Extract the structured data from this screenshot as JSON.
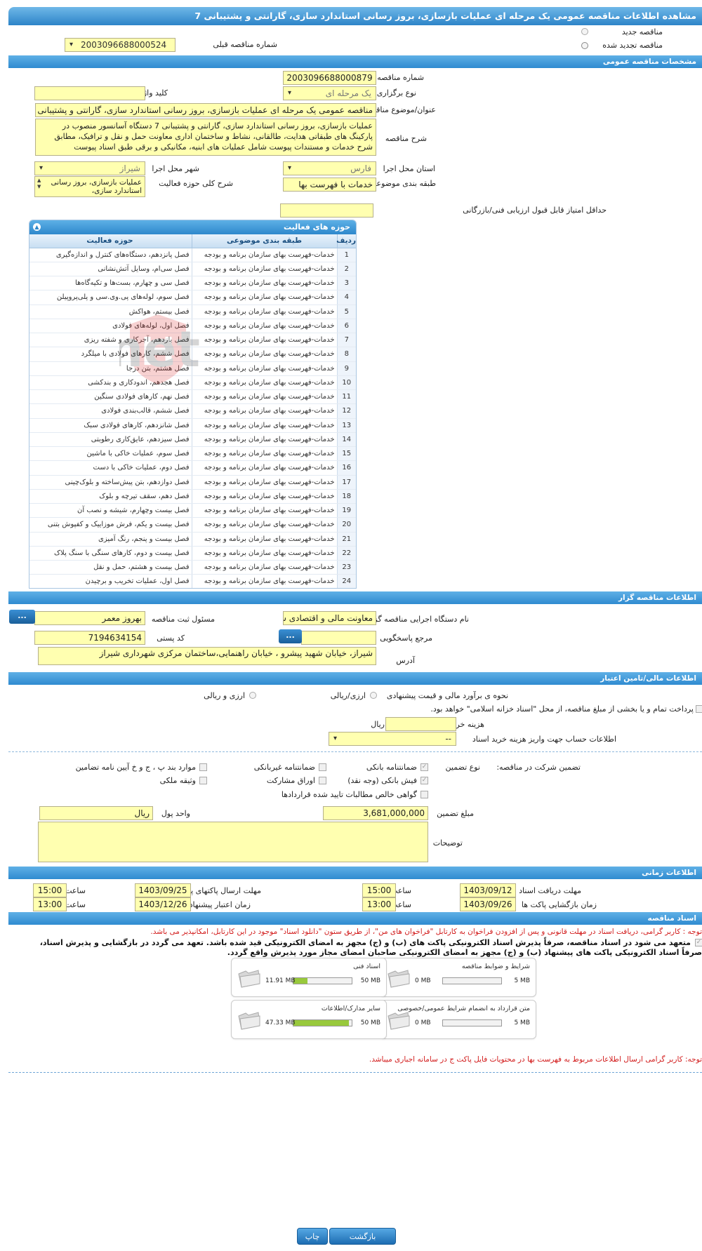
{
  "page_title": "مشاهده اطلاعات مناقصه عمومی یک مرحله ای عملیات بازسازی، بروز رسانی استاندارد سازی، گارانتی و پشتیبانی 7",
  "tender_type": {
    "new_label": "مناقصه جدید",
    "renewed_label": "مناقصه تجدید شده",
    "prev_number_label": "شماره مناقصه قبلی",
    "prev_number": "2003096688000524"
  },
  "general": {
    "section_title": "مشخصات مناقصه عمومی",
    "number_label": "شماره مناقصه",
    "number": "2003096688000879",
    "hold_type_label": "نوع برگزاری",
    "hold_type": "یک مرحله ای",
    "keyword_label": "کلید واژه",
    "keyword": "",
    "subject_label": "عنوان/موضوع مناقصه",
    "subject": "مناقصه عمومی یک مرحله ای عملیات بازسازی، بروز رسانی استاندارد سازی، گارانتی و پشتیبانی 7",
    "description_label": "شرح مناقصه",
    "description": "عملیات بازسازی، بروز رسانی استاندارد سازی، گارانتی و پشتیبانی 7 دستگاه آسانسور منصوب در پارکینگ های طبقاتی هدایت، طالقانی، نشاط و ساختمان اداری معاونت حمل و نقل و ترافیک، مطابق شرح خدمات و مستندات پیوست شامل عملیات های ابنیه، مکانیکی و برقی طبق اسناد پیوست",
    "province_label": "استان محل اجرا",
    "province": "فارس",
    "city_label": "شهر محل اجرا",
    "city": "شیراز",
    "category_label": "طبقه بندی موضوعی",
    "category": "خدمات با فهرست بها",
    "activity_desc_label": "شرح کلی حوزه فعالیت",
    "activity_desc": "عملیات بازسازی، بروز رسانی استاندارد سازی،",
    "min_score_label": "حداقل امتیاز قابل قبول ارزیابی فنی/بازرگانی",
    "min_score": ""
  },
  "activity_grid": {
    "title": "حوزه های فعالیت",
    "headers": {
      "row": "ردیف",
      "category": "طبقه بندی موضوعی",
      "activity": "حوزه فعالیت"
    },
    "rows": [
      {
        "n": "1",
        "cat": "خدمات-فهرست بهای سازمان برنامه و بودجه",
        "act": "فصل پانزدهم، دستگاه‌های کنترل و اندازه‌گیری"
      },
      {
        "n": "2",
        "cat": "خدمات-فهرست بهای سازمان برنامه و بودجه",
        "act": "فصل سی‌ام، وسایل آتش‌نشانی"
      },
      {
        "n": "3",
        "cat": "خدمات-فهرست بهای سازمان برنامه و بودجه",
        "act": "فصل سی و چهارم، بست‌ها و تکیه‌گاه‌ها"
      },
      {
        "n": "4",
        "cat": "خدمات-فهرست بهای سازمان برنامه و بودجه",
        "act": "فصل سوم، لوله‌های پی.وی.سی و پلی‌پروپیلن"
      },
      {
        "n": "5",
        "cat": "خدمات-فهرست بهای سازمان برنامه و بودجه",
        "act": "فصل بیستم، هواکش"
      },
      {
        "n": "6",
        "cat": "خدمات-فهرست بهای سازمان برنامه و بودجه",
        "act": "فصل اول، لوله‌های فولادی"
      },
      {
        "n": "7",
        "cat": "خدمات-فهرست بهای سازمان برنامه و بودجه",
        "act": "فصل یازدهم، آجرکاری و شفته ریزی"
      },
      {
        "n": "8",
        "cat": "خدمات-فهرست بهای سازمان برنامه و بودجه",
        "act": "فصل ششم، کارهای فولادی با میلگرد"
      },
      {
        "n": "9",
        "cat": "خدمات-فهرست بهای سازمان برنامه و بودجه",
        "act": "فصل هشتم، بتن درجا"
      },
      {
        "n": "10",
        "cat": "خدمات-فهرست بهای سازمان برنامه و بودجه",
        "act": "فصل هجدهم، اندودکاری و بندکشی"
      },
      {
        "n": "11",
        "cat": "خدمات-فهرست بهای سازمان برنامه و بودجه",
        "act": "فصل نهم، کارهای فولادی سنگین"
      },
      {
        "n": "12",
        "cat": "خدمات-فهرست بهای سازمان برنامه و بودجه",
        "act": "فصل ششم، قالب‌بندی فولادی"
      },
      {
        "n": "13",
        "cat": "خدمات-فهرست بهای سازمان برنامه و بودجه",
        "act": "فصل شانزدهم، کارهای فولادی سبک"
      },
      {
        "n": "14",
        "cat": "خدمات-فهرست بهای سازمان برنامه و بودجه",
        "act": "فصل سیزدهم، عایق‌کاری رطوبتی"
      },
      {
        "n": "15",
        "cat": "خدمات-فهرست بهای سازمان برنامه و بودجه",
        "act": "فصل سوم، عملیات خاکی با ماشین"
      },
      {
        "n": "16",
        "cat": "خدمات-فهرست بهای سازمان برنامه و بودجه",
        "act": "فصل دوم، عملیات خاکی با دست"
      },
      {
        "n": "17",
        "cat": "خدمات-فهرست بهای سازمان برنامه و بودجه",
        "act": "فصل دوازدهم، بتن پیش‌ساخته و بلوک‌چینی"
      },
      {
        "n": "18",
        "cat": "خدمات-فهرست بهای سازمان برنامه و بودجه",
        "act": "فصل دهم، سقف تیرچه و بلوک"
      },
      {
        "n": "19",
        "cat": "خدمات-فهرست بهای سازمان برنامه و بودجه",
        "act": "فصل بیست وچهارم، شیشه و نصب آن"
      },
      {
        "n": "20",
        "cat": "خدمات-فهرست بهای سازمان برنامه و بودجه",
        "act": "فصل بیست و یکم، فرش موزاییک و کفپوش بتنی"
      },
      {
        "n": "21",
        "cat": "خدمات-فهرست بهای سازمان برنامه و بودجه",
        "act": "فصل بیست و پنجم، رنگ آمیزی"
      },
      {
        "n": "22",
        "cat": "خدمات-فهرست بهای سازمان برنامه و بودجه",
        "act": "فصل بیست و دوم، کارهای سنگی با سنگ پلاک"
      },
      {
        "n": "23",
        "cat": "خدمات-فهرست بهای سازمان برنامه و بودجه",
        "act": "فصل بیست و هشتم، حمل و نقل"
      },
      {
        "n": "24",
        "cat": "خدمات-فهرست بهای سازمان برنامه و بودجه",
        "act": "فصل اول، عملیات تخریب و برچیدن"
      }
    ]
  },
  "watermark": "Hezartender.net",
  "organizer": {
    "section_title": "اطلاعات مناقصه گزار",
    "org_label": "نام دستگاه اجرایی مناقصه گزار",
    "org": "معاونت مالی و اقتصادی شهرداری شیراز",
    "registrar_label": "مسئول ثبت مناقصه",
    "registrar": "بهروز معمر",
    "reference_label": "مرجع پاسخگویی",
    "reference": "",
    "postal_label": "کد پستی",
    "postal": "7194634154",
    "address_label": "آدرس",
    "address": "شیراز، خیابان شهید پیشرو ، خیابان راهنمایی،ساختمان مرکزی شهرداری شیراز",
    "dots": "..."
  },
  "financial": {
    "section_title": "اطلاعات مالی/تامین اعتبار",
    "estimate_label": "نحوه ی برآورد مالی و قیمت پیشنهادی",
    "opt_rial": "ارزی/ریالی",
    "opt_fx": "ارزی و ریالی",
    "treasury_note": "پرداخت تمام و یا بخشی از مبلغ مناقصه، از محل \"اسناد خزانه اسلامی\" خواهد بود.",
    "doc_fee_label": "هزینه خرید اسناد",
    "doc_fee_unit": "ریال",
    "doc_fee": "",
    "account_label": "اطلاعات حساب جهت واریز هزینه خرید اسناد",
    "account": "--"
  },
  "guarantee": {
    "title_label": "تضمین شرکت در مناقصه:",
    "type_label": "نوع تضمین",
    "opts": [
      "ضمانتنامه بانکی",
      "ضمانتنامه غیربانکی",
      "موارد بند پ ، ج و خ آیین نامه تضامین",
      "فیش بانکی (وجه نقد)",
      "اوراق مشارکت",
      "وثیقه ملکی",
      "گواهی خالص مطالبات تایید شده قراردادها"
    ],
    "amount_label": "مبلغ تضمین",
    "amount": "3,681,000,000",
    "currency_label": "واحد پول",
    "currency": "ریال",
    "notes_label": "توضیحات",
    "notes": ""
  },
  "timing": {
    "section_title": "اطلاعات زمانی",
    "receive_label": "مهلت دریافت اسناد",
    "receive_date": "1403/09/12",
    "receive_time": "15:00",
    "send_label": "مهلت ارسال پاکتهای پیشنهاد",
    "send_date": "1403/09/25",
    "send_time": "15:00",
    "open_label": "زمان بازگشایی پاکت ها",
    "open_date": "1403/09/26",
    "open_time": "13:00",
    "valid_label": "زمان اعتبار پیشنهاد",
    "valid_date": "1403/12/26",
    "valid_time": "13:00",
    "time_label": "ساعت"
  },
  "documents": {
    "section_title": "اسناد مناقصه",
    "note1": "توجه : کاربر گرامی، دریافت اسناد در مهلت قانونی و پس از افزودن فراخوان به کارتابل \"فراخوان های من\"، از طریق ستون \"دانلود اسناد\" موجود در این کارتابل، امکانپذیر می باشد.",
    "note2": "متعهد می شود در اسناد مناقصه، صرفاً پذیرش اسناد الکترونیکی پاکت های (ب) و (ج) مجهز به امضای الکترونیکی قید شده باشد. تعهد می گردد در بازگشایی و پذیرش اسناد،",
    "note3": "صرفاً اسناد الکترونیکی پاکت های پیشنهاد (ب) و (ج) مجهز به امضای الکترونیکی صاحبان امضای مجاز مورد پذیرش واقع گردد.",
    "boxes": [
      {
        "name": "شرایط و ضوابط مناقصه",
        "used": "0 MB",
        "max": "5 MB",
        "fill": 0
      },
      {
        "name": "اسناد فنی",
        "used": "11.91 MB",
        "max": "50 MB",
        "fill": 0.24
      },
      {
        "name": "متن قرارداد به انضمام شرایط عمومی/خصوصی",
        "used": "0 MB",
        "max": "5 MB",
        "fill": 0
      },
      {
        "name": "سایر مدارک/اطلاعات",
        "used": "47.33 MB",
        "max": "50 MB",
        "fill": 0.95
      }
    ],
    "note4": "توجه: کاربر گرامی ارسال اطلاعات مربوط به فهرست بها در محتویات فایل پاکت ج در سامانه اجباری میباشد."
  },
  "footer": {
    "back": "بازگشت",
    "print": "چاپ"
  }
}
